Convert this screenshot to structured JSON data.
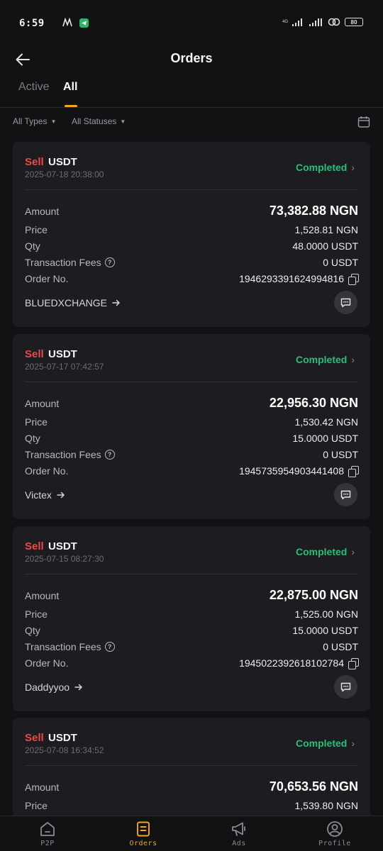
{
  "status_bar": {
    "time": "6:59",
    "net_label": "4G",
    "battery": "80"
  },
  "header": {
    "title": "Orders"
  },
  "tabs": [
    {
      "label": "Active",
      "active": false
    },
    {
      "label": "All",
      "active": true
    }
  ],
  "filters": {
    "types": "All Types",
    "statuses": "All Statuses"
  },
  "labels": {
    "amount": "Amount",
    "price": "Price",
    "qty": "Qty",
    "fees": "Transaction Fees",
    "order_no": "Order No."
  },
  "orders": [
    {
      "side": "Sell",
      "asset": "USDT",
      "datetime": "2025-07-18 20:38:00",
      "status": "Completed",
      "amount": "73,382.88 NGN",
      "price": "1,528.81 NGN",
      "qty": "48.0000 USDT",
      "fees": "0 USDT",
      "order_no": "1946293391624994816",
      "merchant": "BLUEDXCHANGE"
    },
    {
      "side": "Sell",
      "asset": "USDT",
      "datetime": "2025-07-17 07:42:57",
      "status": "Completed",
      "amount": "22,956.30 NGN",
      "price": "1,530.42 NGN",
      "qty": "15.0000 USDT",
      "fees": "0 USDT",
      "order_no": "1945735954903441408",
      "merchant": "Victex"
    },
    {
      "side": "Sell",
      "asset": "USDT",
      "datetime": "2025-07-15 08:27:30",
      "status": "Completed",
      "amount": "22,875.00 NGN",
      "price": "1,525.00 NGN",
      "qty": "15.0000 USDT",
      "fees": "0 USDT",
      "order_no": "1945022392618102784",
      "merchant": "Daddyyoo"
    },
    {
      "side": "Sell",
      "asset": "USDT",
      "datetime": "2025-07-08 16:34:52",
      "status": "Completed",
      "amount": "70,653.56 NGN",
      "price": "1,539.80 NGN"
    }
  ],
  "bottom_nav": [
    {
      "label": "P2P",
      "icon": "home-icon",
      "active": false
    },
    {
      "label": "Orders",
      "icon": "orders-icon",
      "active": true
    },
    {
      "label": "Ads",
      "icon": "megaphone-icon",
      "active": false
    },
    {
      "label": "Profile",
      "icon": "profile-icon",
      "active": false
    }
  ],
  "colors": {
    "accent": "#f0a81f",
    "sell": "#e84a4a",
    "completed": "#2dbd79",
    "background": "#121214",
    "card": "#1d1d21"
  }
}
